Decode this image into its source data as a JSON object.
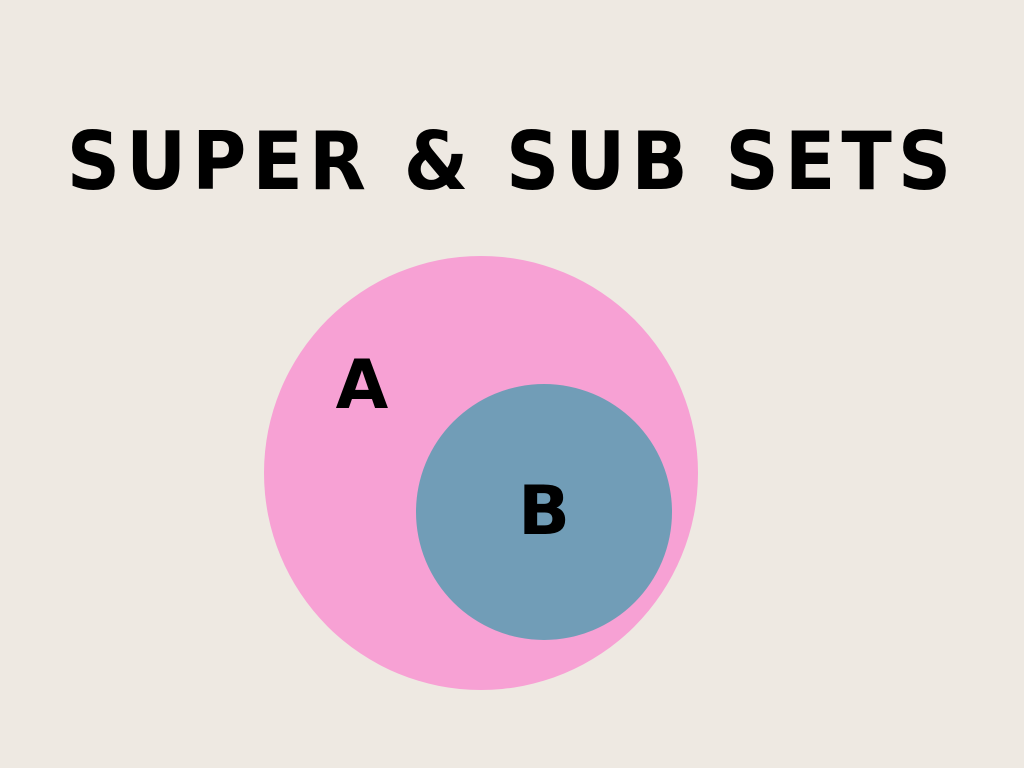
{
  "title": "SUPER & SUB SETS",
  "colors": {
    "background": "#eee9e2",
    "superset_fill": "#f7a1d4",
    "subset_fill": "#719db7",
    "text": "#000000"
  },
  "sets": {
    "superset": {
      "label": "A"
    },
    "subset": {
      "label": "B"
    }
  }
}
